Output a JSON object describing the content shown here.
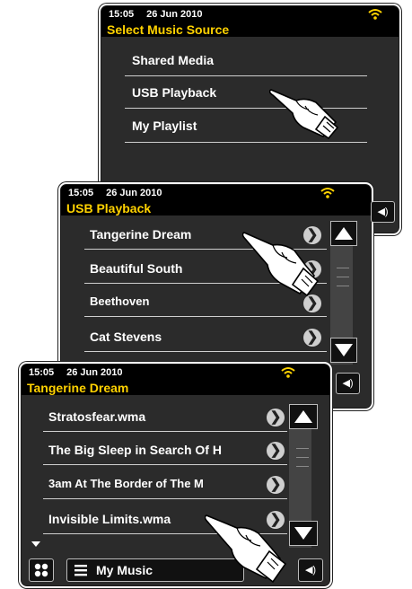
{
  "status": {
    "time": "15:05",
    "date": "26 Jun 2010"
  },
  "screen1": {
    "title": "Select Music Source",
    "items": [
      "Shared Media",
      "USB Playback",
      "My Playlist"
    ]
  },
  "screen2": {
    "title": "USB Playback",
    "items": [
      "Tangerine Dream",
      "Beautiful South",
      "Beethoven",
      "Cat Stevens"
    ]
  },
  "screen3": {
    "title": "Tangerine Dream",
    "items": [
      "Stratosfear.wma",
      "The Big Sleep in Search Of H",
      "3am At The Border of The M",
      "Invisible Limits.wma"
    ],
    "bottom_menu_label": "My Music"
  },
  "icons": {
    "wifi": "wifi-icon",
    "chevron": "chevron-right-icon",
    "up": "arrow-up-icon",
    "down": "arrow-down-icon",
    "volume": "volume-icon",
    "menu": "menu-icon",
    "grid": "grid-icon",
    "hand": "pointing-hand-icon"
  },
  "colors": {
    "title": "#ffd200",
    "background": "#2b2b2b",
    "bar": "#000000"
  }
}
